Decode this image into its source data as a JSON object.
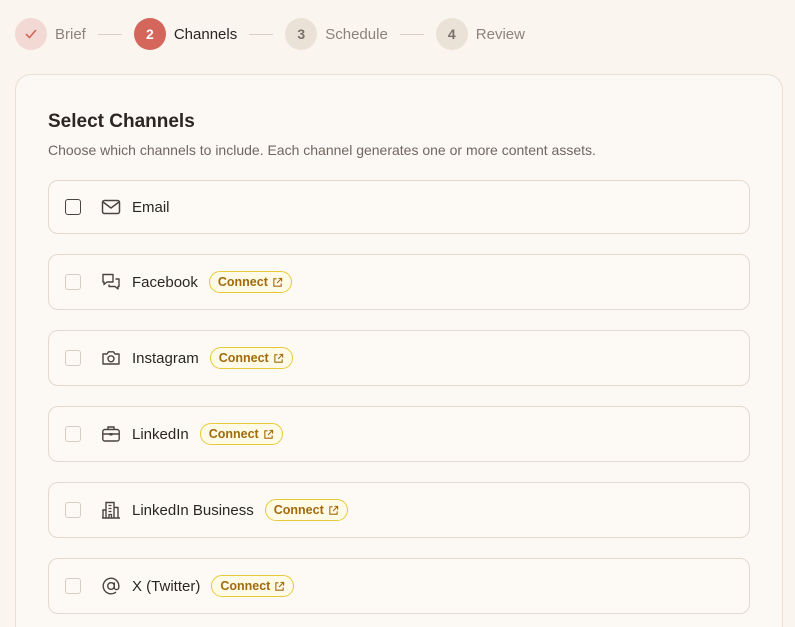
{
  "stepper": {
    "steps": [
      {
        "label": "Brief",
        "number": "",
        "state": "done"
      },
      {
        "label": "Channels",
        "number": "2",
        "state": "active"
      },
      {
        "label": "Schedule",
        "number": "3",
        "state": "todo"
      },
      {
        "label": "Review",
        "number": "4",
        "state": "todo"
      }
    ]
  },
  "card": {
    "title": "Select Channels",
    "subtitle": "Choose which channels to include. Each channel generates one or more content assets."
  },
  "channels": [
    {
      "label": "Email",
      "icon": "mail-icon",
      "connect": ""
    },
    {
      "label": "Facebook",
      "icon": "chat-bubbles-icon",
      "connect": "Connect"
    },
    {
      "label": "Instagram",
      "icon": "camera-icon",
      "connect": "Connect"
    },
    {
      "label": "LinkedIn",
      "icon": "briefcase-icon",
      "connect": "Connect"
    },
    {
      "label": "LinkedIn Business",
      "icon": "building-icon",
      "connect": "Connect"
    },
    {
      "label": "X (Twitter)",
      "icon": "at-sign-icon",
      "connect": "Connect"
    }
  ],
  "colors": {
    "accent": "#d4665c",
    "connect_border": "#e8c93a",
    "connect_text": "#a36a0b"
  }
}
